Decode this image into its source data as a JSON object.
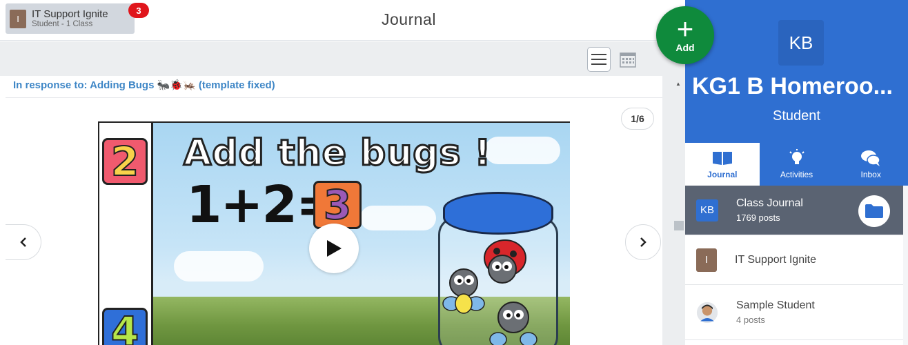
{
  "account": {
    "initial": "I",
    "name": "IT Support Ignite",
    "role": "Student - 1 Class",
    "badge_count": "3"
  },
  "header": {
    "title": "Journal"
  },
  "toolbar": {
    "list_view_icon": "list-icon",
    "calendar_view_icon": "calendar-icon"
  },
  "post": {
    "response_prefix": "In response to: Adding Bugs",
    "response_emoji": "🐜🐞🦗",
    "response_suffix": "(template fixed)",
    "page_counter": "1/6",
    "slide": {
      "title": "Add the bugs !",
      "equation": "1+2=",
      "answer": "3",
      "side_numbers": [
        "2",
        "4"
      ]
    }
  },
  "add_button": {
    "label": "Add"
  },
  "sidebar": {
    "class_initials": "KB",
    "class_name": "KG1 B Homeroo...",
    "class_role": "Student",
    "tabs": [
      {
        "label": "Journal",
        "icon": "book-icon",
        "active": true
      },
      {
        "label": "Activities",
        "icon": "lightbulb-icon",
        "active": false
      },
      {
        "label": "Inbox",
        "icon": "chat-icon",
        "active": false
      }
    ],
    "rows": [
      {
        "initials": "KB",
        "title": "Class Journal",
        "sub": "1769 posts",
        "color": "#2f6fd1"
      },
      {
        "initials": "I",
        "title": "IT Support Ignite",
        "sub": "",
        "color": "#8a6b58"
      },
      {
        "initials": "",
        "title": "Sample Student",
        "sub": "4 posts",
        "color": "#e3e6ea"
      }
    ]
  },
  "colors": {
    "accent": "#2f6fd1",
    "add_green": "#0f8a3c",
    "badge_red": "#e0161c",
    "link_blue": "#3e86c6"
  }
}
